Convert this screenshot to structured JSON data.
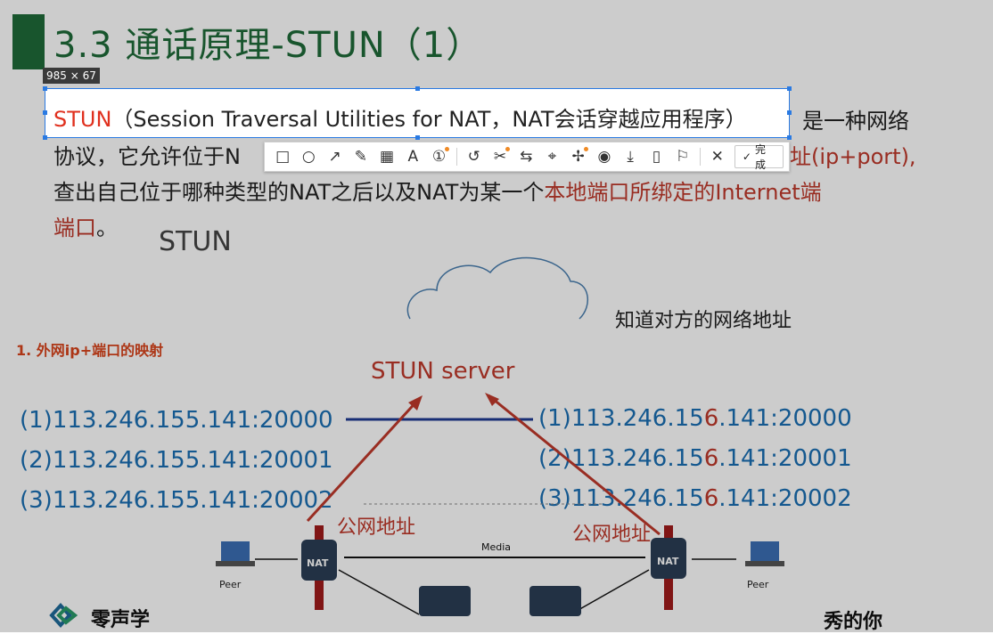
{
  "slide": {
    "title": "3.3 通话原理-STUN（1）",
    "para_line2_a": "协议，它允许位于N",
    "para_line2_b": "址(ip+port),",
    "para_line3_a": "查出自己位于哪种类型的NAT之后以及NAT为某一个",
    "para_line3_b": "本地端口所绑定的Internet端",
    "para_line4_a": "端口",
    "para_line4_b": "。",
    "para_line1_tail": "是一种网络"
  },
  "selection": {
    "size_badge": "985 × 67",
    "text_red": "STUN",
    "text_rest": "（Session Traversal Utilities for NAT，NAT会话穿越应用程序）"
  },
  "toolbar": {
    "tools": [
      {
        "name": "rectangle-icon",
        "glyph": "□"
      },
      {
        "name": "ellipse-icon",
        "glyph": "○"
      },
      {
        "name": "arrow-icon",
        "glyph": "↗"
      },
      {
        "name": "pen-icon",
        "glyph": "✎"
      },
      {
        "name": "mosaic-icon",
        "glyph": "▦"
      },
      {
        "name": "text-icon",
        "glyph": "A"
      },
      {
        "name": "number-icon",
        "glyph": "①"
      }
    ],
    "tools2": [
      {
        "name": "undo-icon",
        "glyph": "↺"
      },
      {
        "name": "extract-icon",
        "glyph": "✂"
      },
      {
        "name": "translate-icon",
        "glyph": "⇆"
      },
      {
        "name": "scan-icon",
        "glyph": "⌖"
      },
      {
        "name": "pin-icon",
        "glyph": "✢"
      },
      {
        "name": "record-icon",
        "glyph": "◉"
      },
      {
        "name": "download-icon",
        "glyph": "⤓"
      },
      {
        "name": "phone-icon",
        "glyph": "▯"
      },
      {
        "name": "bookmark-icon",
        "glyph": "⚐"
      }
    ],
    "close_glyph": "✕",
    "done_label": "完成"
  },
  "diagram": {
    "stun_logo": "STUN",
    "cloud_label": "知道对方的网络地址",
    "mapping_title": "1. 外网ip+端口的映射",
    "server_label": "STUN server",
    "left_ips": [
      "(1)113.246.155.141:20000",
      "(2)113.246.155.141:20001",
      "(3)113.246.155.141:20002"
    ],
    "right_ip_prefix": [
      "(1)113.246.15",
      "(2)113.246.15",
      "(3)113.246.15"
    ],
    "right_ip_digit": "6",
    "right_ip_suffix": [
      ".141:20000",
      ".141:20001",
      ".141:20002"
    ],
    "public_addr": "公网地址",
    "media_label": "Media",
    "nat_label": "NAT",
    "peer_label": "Peer",
    "brand": "零声学",
    "footer_right": "秀的你"
  }
}
